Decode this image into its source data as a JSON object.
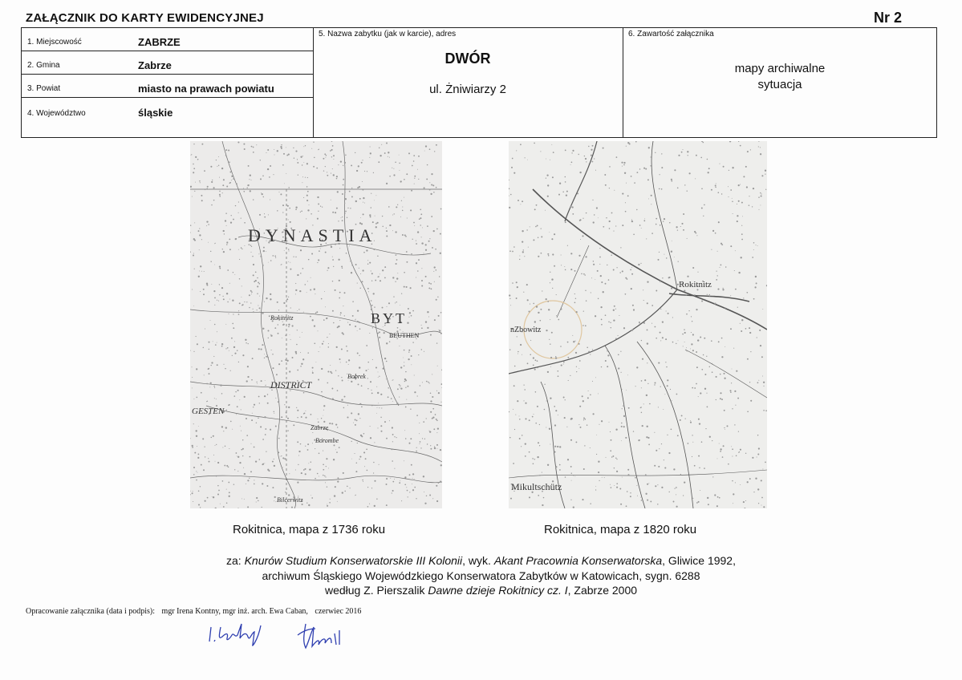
{
  "header": {
    "title": "ZAŁĄCZNIK DO KARTY EWIDENCYJNEJ",
    "number": "Nr 2"
  },
  "fields": [
    {
      "label": "1. Miejscowość",
      "value": "ZABRZE"
    },
    {
      "label": "2. Gmina",
      "value": "Zabrze"
    },
    {
      "label": "3. Powiat",
      "value": "miasto na prawach powiatu"
    },
    {
      "label": "4. Województwo",
      "value": "śląskie"
    }
  ],
  "monument": {
    "caption": "5. Nazwa zabytku (jak w karcie), adres",
    "name": "DWÓR",
    "address": "ul. Żniwiarzy 2"
  },
  "contents": {
    "caption": "6. Zawartość załącznika",
    "line1": "mapy archiwalne",
    "line2": "sytuacja"
  },
  "maps": [
    {
      "caption": "Rokitnica, mapa z 1736 roku",
      "labels": [
        "DYNASTIA",
        "BYT",
        "DISTRICT",
        "GESTEN",
        "BEUTHEN",
        "Rokitnitz",
        "Zabrze",
        "Bobrek",
        "Borombe",
        "Bilcerwitz"
      ]
    },
    {
      "caption": "Rokitnica, mapa z 1820 roku",
      "labels": [
        "Rokitnitz",
        "Mikultschütz",
        "nZbowitz"
      ]
    }
  ],
  "source": {
    "prefix": "za: ",
    "title1": "Knurów Studium Konserwatorskie III Kolonii",
    "mid1": ", wyk. ",
    "author1": "Akant Pracownia Konserwatorska",
    "tail1": ", Gliwice 1992,",
    "line2": "archiwum Śląskiego Wojewódzkiego Konserwatora Zabytków w Katowicach, sygn. 6288",
    "line3_prefix": "według Z. Pierszalik ",
    "line3_title": "Dawne dzieje Rokitnicy cz. I",
    "line3_tail": ", Zabrze 2000"
  },
  "prepared": {
    "label": "Opracowanie załącznika (data i podpis):",
    "authors": "mgr Irena Kontny, mgr inż. arch. Ewa Caban,",
    "date": "czerwiec 2016"
  },
  "signature_color": "#2f3fb0"
}
